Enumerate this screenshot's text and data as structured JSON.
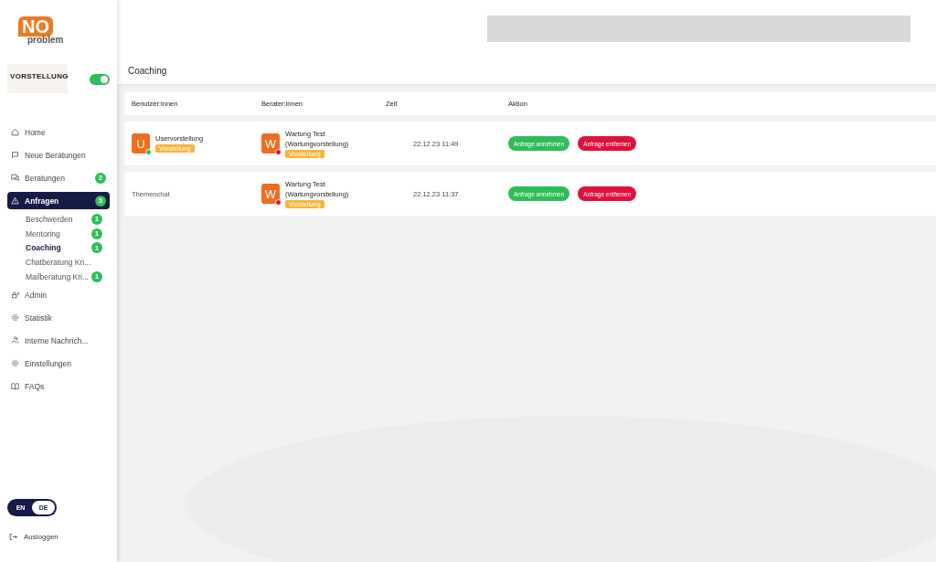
{
  "logo": {
    "mark": "NO",
    "word": "problem"
  },
  "agency": {
    "name": "VORSTELLUNG",
    "online": true
  },
  "nav": [
    {
      "label": "Home",
      "kind": "home",
      "selected": false
    },
    {
      "label": "Neue Beratungen",
      "kind": "new",
      "selected": false
    },
    {
      "label": "Beratungen",
      "kind": "chat",
      "badge": "2",
      "selected": false
    },
    {
      "label": "Anfragen",
      "kind": "warn",
      "badge": "5",
      "selected": true,
      "children": [
        {
          "label": "Beschwerden",
          "badge": "1",
          "selected": false
        },
        {
          "label": "Mentoring",
          "badge": "1",
          "selected": false
        },
        {
          "label": "Coaching",
          "badge": "1",
          "selected": true
        },
        {
          "label": "Chatberatung Kri...",
          "selected": false
        },
        {
          "label": "Mailberatung Kri...",
          "badge": "1",
          "selected": false
        }
      ]
    },
    {
      "label": "Admin",
      "kind": "admin",
      "selected": false
    },
    {
      "label": "Statistik",
      "kind": "gear",
      "selected": false
    },
    {
      "label": "Interne Nachrich...",
      "kind": "people",
      "selected": false
    },
    {
      "label": "Einstellungen",
      "kind": "gear",
      "selected": false
    },
    {
      "label": "FAQs",
      "kind": "book",
      "selected": false
    }
  ],
  "language": [
    {
      "label": "EN",
      "selected": false
    },
    {
      "label": "DE",
      "selected": true
    }
  ],
  "logout": "Ausloggen",
  "page_title": "Coaching",
  "table": {
    "columns": [
      "Benutzer:innen",
      "Berater:innen",
      "Zeit",
      "Aktion"
    ],
    "rows": [
      {
        "user": {
          "kind": "avatar",
          "initial": "U",
          "name": "Uservorstellung",
          "tag": "Vorstellung",
          "color": "#2ebd59"
        },
        "counselor": {
          "initial": "W",
          "name": "Wartung Test",
          "sub": "(Wartungvorstellung)",
          "tag": "Vorstellung",
          "color": "#e0103d"
        },
        "time": "22.12.23 11:49",
        "actions": [
          "Anfrage annehmen",
          "Anfrage entfernen"
        ]
      },
      {
        "user": {
          "kind": "topic",
          "name": "Themenchat"
        },
        "counselor": {
          "initial": "W",
          "name": "Wartung Test",
          "sub": "(Wartungvorstellung)",
          "tag": "Vorstellung",
          "color": "#e0103d"
        },
        "time": "22.12.23 11:37",
        "actions": [
          "Anfrage annehmen",
          "Anfrage entfernen"
        ]
      }
    ]
  }
}
